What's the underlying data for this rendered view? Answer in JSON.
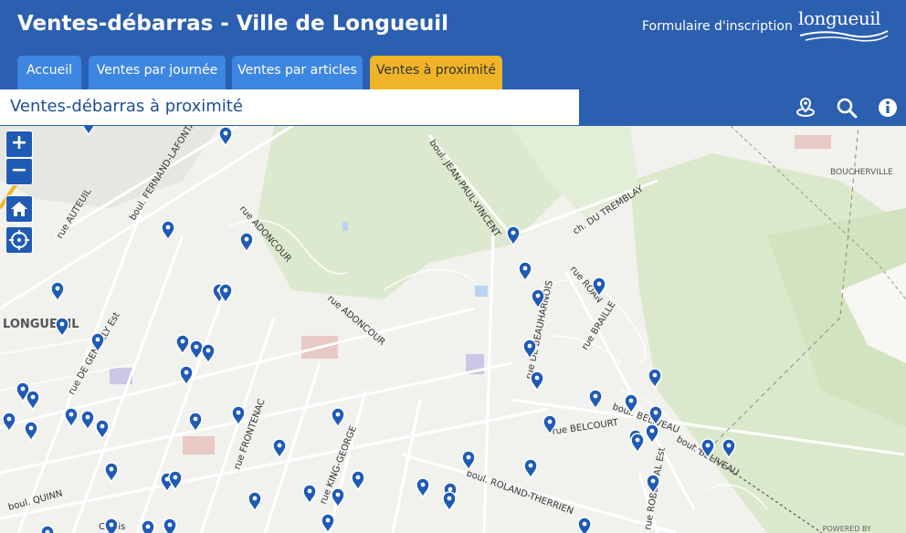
{
  "header": {
    "title": "Ventes-débarras - Ville de Longueuil",
    "signup_link": "Formulaire d'inscription",
    "logo_text": "longueuil",
    "colors": {
      "primary": "#2b5fb0",
      "tab": "#3d86e2",
      "tab_active": "#f0b429"
    }
  },
  "tabs": [
    {
      "label": "Accueil"
    },
    {
      "label": "Ventes par journée"
    },
    {
      "label": "Ventes par articles"
    },
    {
      "label": "Ventes à proximité"
    }
  ],
  "subheader": {
    "title": "Ventes-débarras à proximité",
    "icons": [
      "locate-sales-icon",
      "search-icon",
      "info-icon"
    ]
  },
  "map": {
    "controls": {
      "zoom_in": "+",
      "zoom_out": "−",
      "home_icon": "home-icon",
      "locate_icon": "crosshair-icon"
    },
    "places": {
      "longueuil": "LONGUEUIL",
      "boucherville": "BOUCHERVILLE"
    },
    "streets": {
      "auteuil": "rue AUTEUIL",
      "fernand": "boul. FERNAND-LAFONTAINE",
      "adoncour1": "rue ADONCOUR",
      "adoncour2": "rue ADONCOUR",
      "jean_paul": "boul. JEAN-PAUL-VINCENT",
      "tremblay": "ch. DU TREMBLAY",
      "roan": "rue ROAN",
      "braille": "rue BRAILLE",
      "beauharnois": "rue DE BEAUHARNOIS",
      "gentilly": "rue DE GENTILLY Est",
      "frontenac": "rue FRONTENAC",
      "king_george": "rue KING-GEORGE",
      "belcourt": "rue BELCOURT",
      "beliveau1": "boul. BELIVEAU",
      "beliveau2": "boul. BELIVEAU",
      "roland": "boul. ROLAND-THERRIEN",
      "roberval": "rue ROBERVAL Est",
      "quinn": "boul. QUINN",
      "curtis": "Curtis"
    },
    "attribution": "POWERED BY"
  }
}
